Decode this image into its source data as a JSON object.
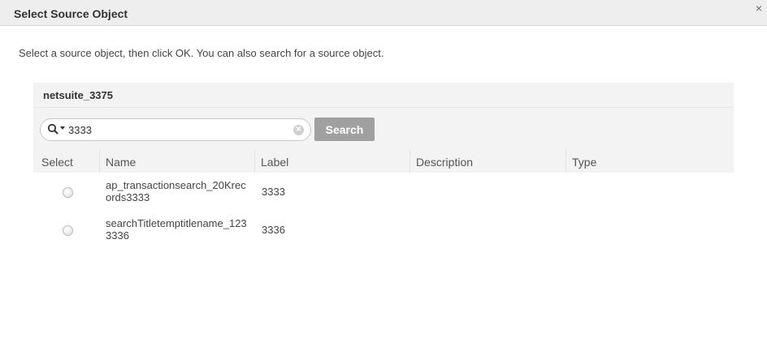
{
  "dialog": {
    "title": "Select Source Object",
    "close_glyph": "×",
    "instructions": "Select a source object, then click OK. You can also search for a source object."
  },
  "panel": {
    "connection_name": "netsuite_3375"
  },
  "search": {
    "value": "3333",
    "button_label": "Search",
    "icon": "magnifier-dropdown-icon",
    "clear_icon": "clear-circle-icon"
  },
  "table": {
    "columns": [
      "Select",
      "Name",
      "Label",
      "Description",
      "Type"
    ],
    "rows": [
      {
        "name": "ap_transactionsearch_20Krecords3333",
        "label": "3333",
        "description": "",
        "type": "",
        "selected": false
      },
      {
        "name": "searchTitletemptitlename_1233336",
        "label": "3336",
        "description": "",
        "type": "",
        "selected": false
      }
    ]
  }
}
